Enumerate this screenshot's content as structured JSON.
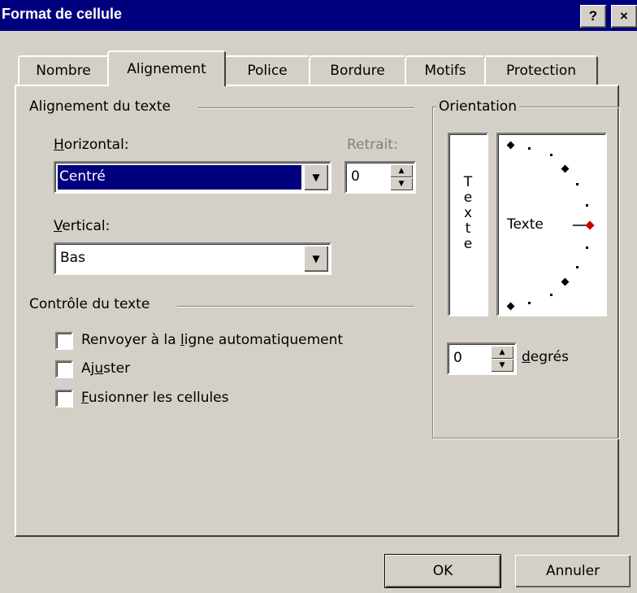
{
  "window": {
    "title": "Format de cellule",
    "help_btn": "?",
    "close_btn": "×"
  },
  "tabs": [
    "Nombre",
    "Alignement",
    "Police",
    "Bordure",
    "Motifs",
    "Protection"
  ],
  "alignment": {
    "section_title": "Alignement du texte",
    "horizontal_label_u": "H",
    "horizontal_label_rest": "orizontal:",
    "horizontal_value": "Centré",
    "indent_label": "Retrait:",
    "indent_value": "0",
    "vertical_label_u": "V",
    "vertical_label_rest": "ertical:",
    "vertical_value": "Bas"
  },
  "text_control": {
    "section_title": "Contrôle du texte",
    "wrap": {
      "pre": "Renvoyer à la ",
      "u": "l",
      "post": "igne automatiquement",
      "checked": false
    },
    "shrink": {
      "pre": "Aj",
      "u": "u",
      "post": "ster",
      "checked": false
    },
    "merge": {
      "pre": "",
      "u": "F",
      "post": "usionner les cellules",
      "checked": false
    }
  },
  "orientation": {
    "section_title": "Orientation",
    "vertical_text": [
      "T",
      "e",
      "x",
      "t",
      "e"
    ],
    "dial_text": "Texte",
    "degrees_value": "0",
    "degrees_label_u": "d",
    "degrees_label_rest": "egrés",
    "indicator_color": "#cc0000"
  },
  "buttons": {
    "ok": "OK",
    "cancel": "Annuler"
  },
  "colors": {
    "titlebar": "#00007f",
    "face": "#d4d0c8",
    "selection": "#00007f"
  }
}
